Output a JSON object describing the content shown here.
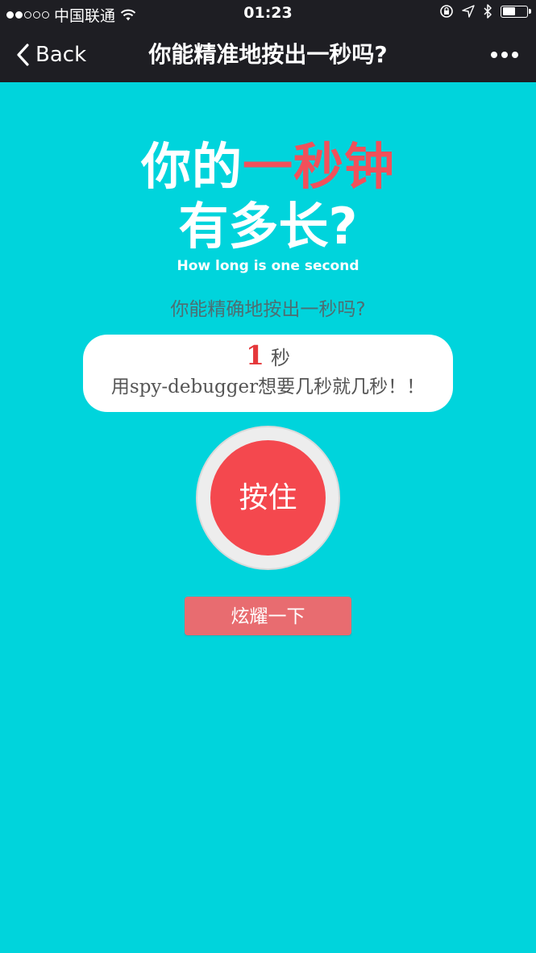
{
  "status_bar": {
    "carrier": "中国联通",
    "time": "01:23",
    "signal_strength": 2,
    "battery_level": 0.55
  },
  "nav": {
    "back_label": "Back",
    "title": "你能精准地按出一秒吗?"
  },
  "logo": {
    "line1_white": "你的",
    "line1_red": "一秒钟",
    "line2": "有多长?",
    "english": "How long is one second"
  },
  "subtitle": "你能精确地按出一秒吗?",
  "result": {
    "value": "1",
    "unit": "秒",
    "message": "用spy-debugger想要几秒就几秒！！"
  },
  "press_button_label": "按住",
  "show_off_button_label": "炫耀一下",
  "colors": {
    "background": "#00D4DC",
    "nav_background": "#1E1E23",
    "accent_red": "#F4484E",
    "button_red": "#E86C70"
  }
}
